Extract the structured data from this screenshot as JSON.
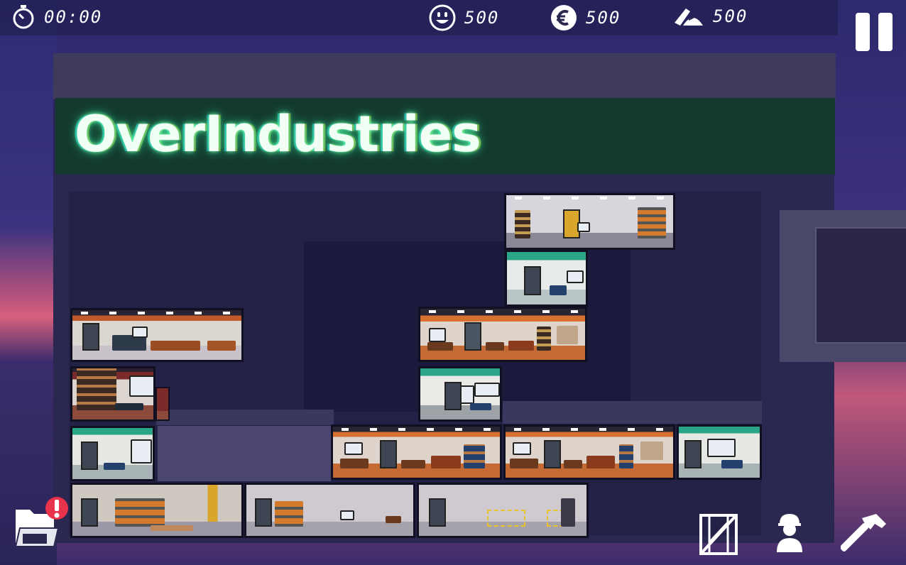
{
  "hud": {
    "timer": {
      "icon": "stopwatch-icon",
      "value": "00:00"
    },
    "happiness": {
      "icon": "smiley-icon",
      "value": "500"
    },
    "money": {
      "icon": "euro-icon",
      "value": "500"
    },
    "materials": {
      "icon": "materials-icon",
      "value": "500"
    }
  },
  "building": {
    "sign_text": "OverIndustries"
  },
  "buttons": {
    "pause": {
      "icon": "pause-icon"
    },
    "folder": {
      "icon": "folder-alert-icon"
    },
    "crate": {
      "icon": "crate-icon"
    },
    "worker": {
      "icon": "worker-icon"
    },
    "build": {
      "icon": "hammer-icon"
    }
  },
  "colors": {
    "sign_bg": "#143a2f",
    "logo_glow": "#2fd68a",
    "hud_text": "#ffffff",
    "alert": "#e8334a"
  }
}
